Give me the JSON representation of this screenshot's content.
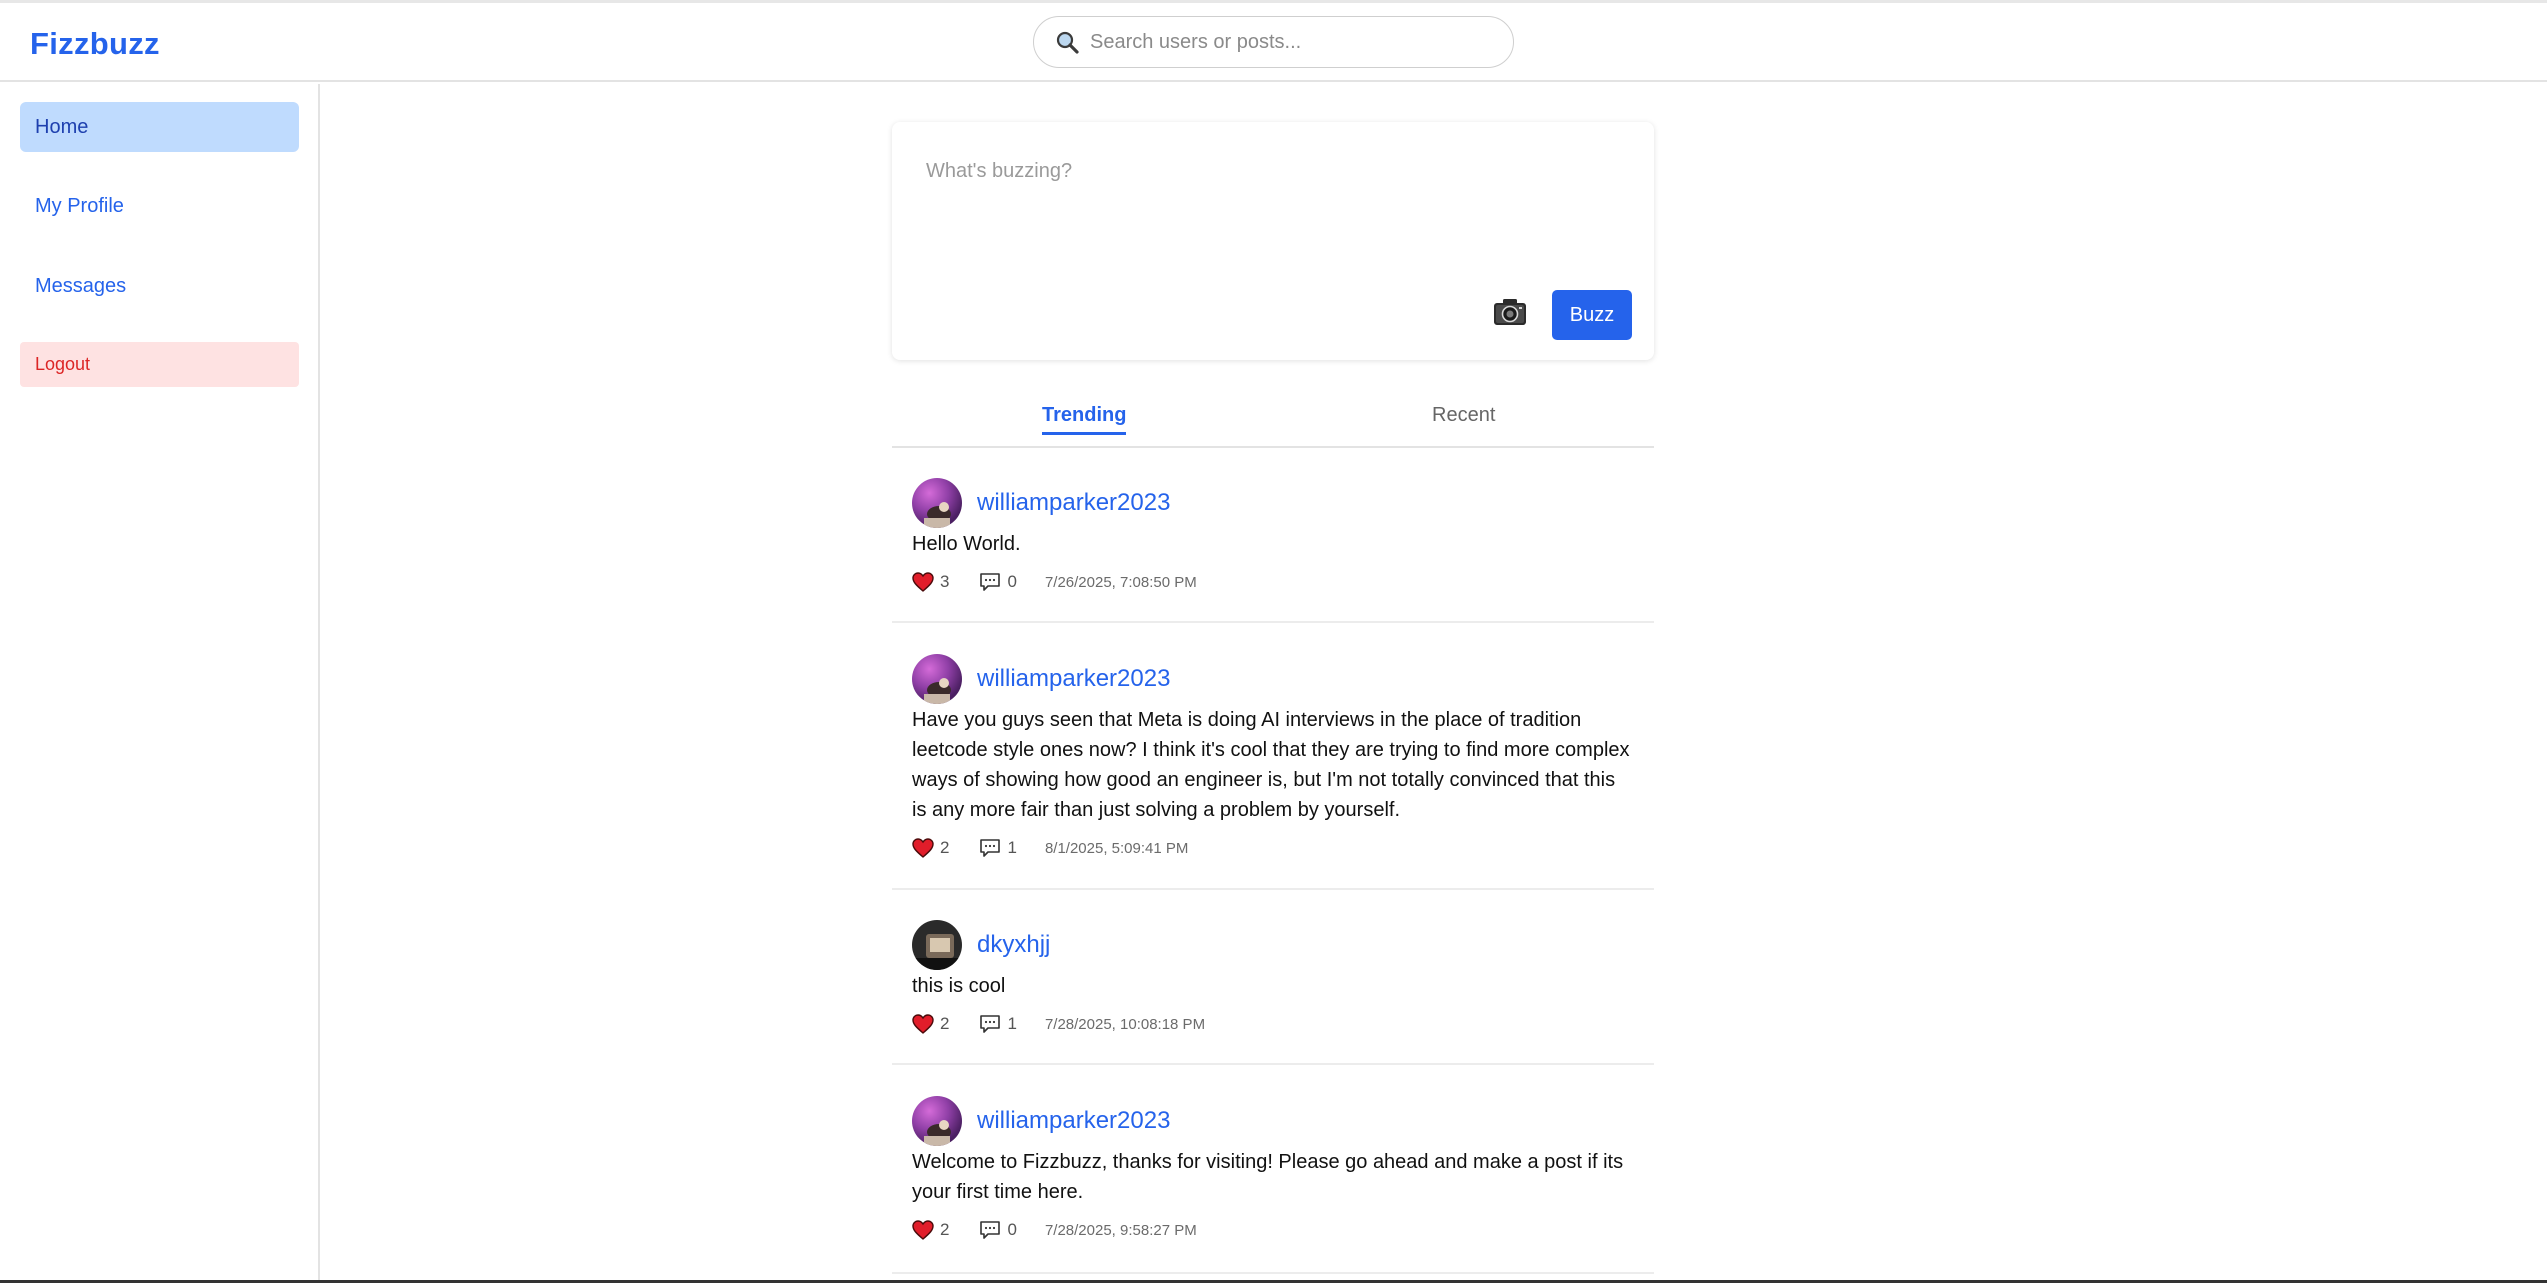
{
  "app": {
    "title": "Fizzbuzz"
  },
  "search": {
    "placeholder": "Search users or posts..."
  },
  "sidebar": {
    "items": [
      {
        "label": "Home",
        "active": true
      },
      {
        "label": "My Profile"
      },
      {
        "label": "Messages"
      },
      {
        "label": "Logout"
      }
    ]
  },
  "composer": {
    "placeholder": "What's buzzing?",
    "submit_label": "Buzz"
  },
  "tabs": [
    {
      "label": "Trending",
      "active": true
    },
    {
      "label": "Recent"
    }
  ],
  "posts": [
    {
      "username": "williamparker2023",
      "text": "Hello World.",
      "likes": "3",
      "comments": "0",
      "timestamp": "7/26/2025, 7:08:50 PM",
      "avatar": "purple-avatar"
    },
    {
      "username": "williamparker2023",
      "text": "Have you guys seen that Meta is doing AI interviews in the place of tradition leetcode style ones now? I think it's cool that they are trying to find more complex ways of showing how good an engineer is, but I'm not totally convinced that this is any more fair than just solving a problem by yourself.",
      "likes": "2",
      "comments": "1",
      "timestamp": "8/1/2025, 5:09:41 PM",
      "avatar": "purple-avatar"
    },
    {
      "username": "dkyxhjj",
      "text": "this is cool",
      "likes": "2",
      "comments": "1",
      "timestamp": "7/28/2025, 10:08:18 PM",
      "avatar": "dark-avatar"
    },
    {
      "username": "williamparker2023",
      "text": "Welcome to Fizzbuzz, thanks for visiting! Please go ahead and make a post if its your first time here.",
      "likes": "2",
      "comments": "0",
      "timestamp": "7/28/2025, 9:58:27 PM",
      "avatar": "purple-avatar"
    }
  ],
  "colors": {
    "accent": "#2563eb",
    "active_nav_bg": "#bfdbfe",
    "logout_bg": "#fee2e2",
    "logout_text": "#dc2626",
    "heart": "#e11d2a"
  }
}
